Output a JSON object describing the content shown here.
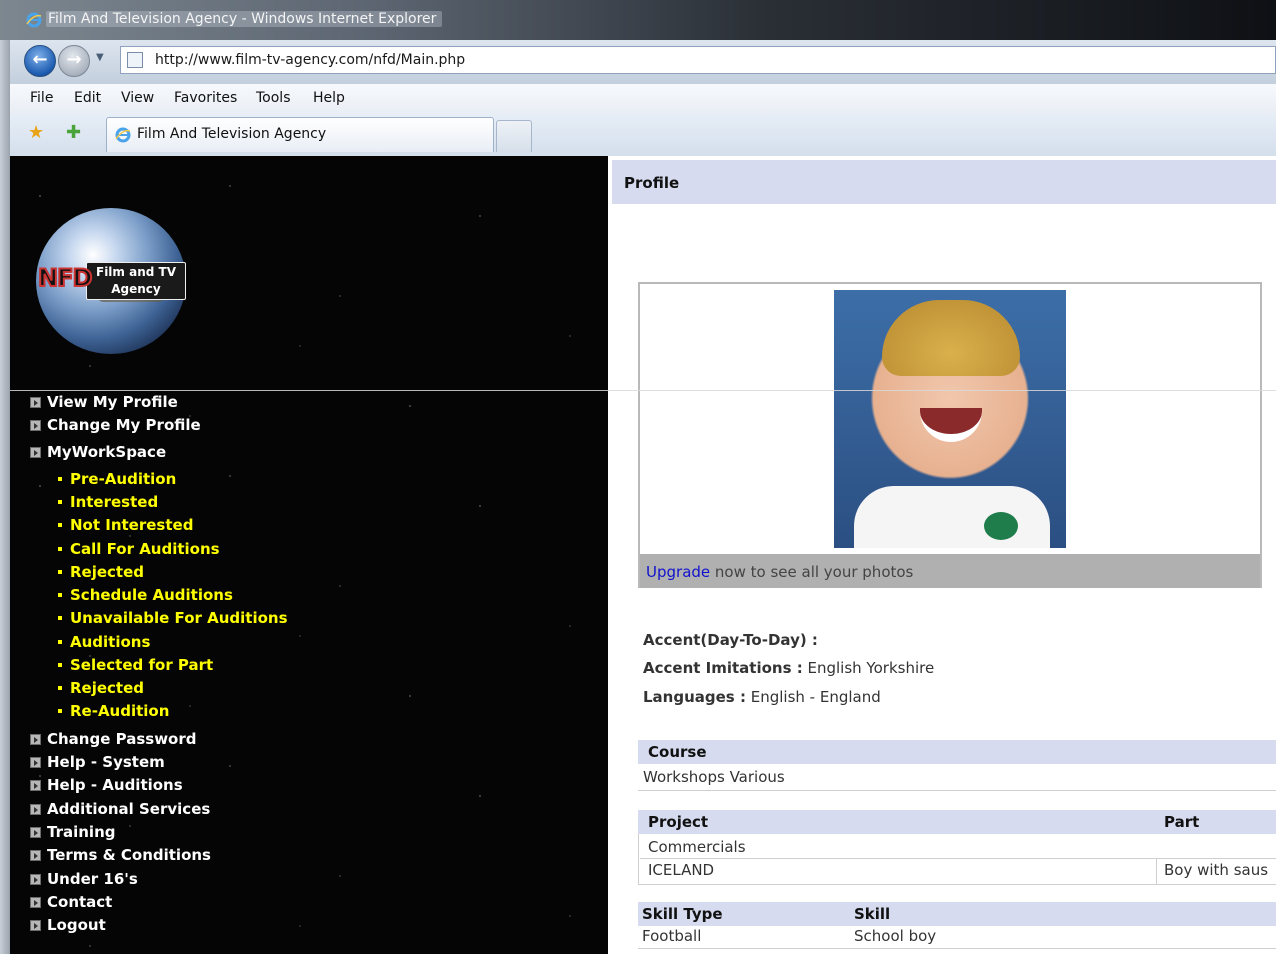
{
  "window": {
    "title": "Film And Television Agency - Windows Internet Explorer"
  },
  "browser": {
    "url": "http://www.film-tv-agency.com/nfd/Main.php",
    "menu": [
      "File",
      "Edit",
      "View",
      "Favorites",
      "Tools",
      "Help"
    ],
    "tab_title": "Film And Television Agency"
  },
  "logo": {
    "line1": "Film and TV",
    "line2": "Agency",
    "mark": "NFD"
  },
  "nav": {
    "top_items": [
      "View My Profile",
      "Change My Profile",
      "MyWorkSpace"
    ],
    "workspace_items": [
      "Pre-Audition",
      "Interested",
      "Not Interested",
      "Call For Auditions",
      "Rejected",
      "Schedule Auditions",
      "Unavailable For Auditions",
      "Auditions",
      "Selected for Part",
      "Rejected",
      "Re-Audition"
    ],
    "bottom_items": [
      "Change Password",
      "Help - System",
      "Help - Auditions",
      "Additional Services",
      "Training",
      "Terms & Conditions",
      "Under 16's",
      "Contact",
      "Logout"
    ]
  },
  "profile": {
    "header": "Profile",
    "upgrade_link": "Upgrade",
    "upgrade_text": " now to see all your photos",
    "accent_label": "Accent(Day-To-Day) :",
    "accent_value": "",
    "imitations_label": "Accent Imitations :",
    "imitations_value": " English Yorkshire",
    "languages_label": "Languages :",
    "languages_value": " English - England"
  },
  "course": {
    "header": "Course",
    "rows": [
      "Workshops Various"
    ]
  },
  "projects": {
    "headers": [
      "Project",
      "Part"
    ],
    "rows": [
      [
        "Commercials",
        ""
      ],
      [
        "ICELAND",
        "Boy with saus"
      ]
    ]
  },
  "skills": {
    "headers": [
      "Skill Type",
      "Skill"
    ],
    "rows": [
      [
        "Football",
        "School boy"
      ]
    ]
  }
}
